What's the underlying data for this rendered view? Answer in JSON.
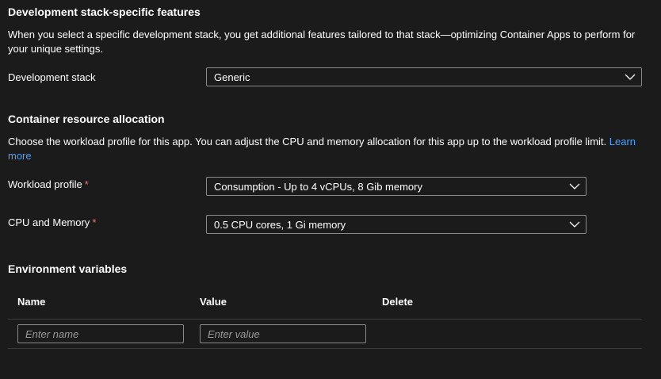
{
  "dev_stack_section": {
    "title": "Development stack-specific features",
    "description": "When you select a specific development stack, you get additional features tailored to that stack—optimizing Container Apps to perform for your unique settings.",
    "field_label": "Development stack",
    "selected_value": "Generic"
  },
  "resource_section": {
    "title": "Container resource allocation",
    "description": "Choose the workload profile for this app. You can adjust the CPU and memory allocation for this app up to the workload profile limit.",
    "learn_more": "Learn more",
    "workload_profile": {
      "label": "Workload profile",
      "required_mark": "*",
      "selected_value": "Consumption - Up to 4 vCPUs, 8 Gib memory"
    },
    "cpu_memory": {
      "label": "CPU and Memory",
      "required_mark": "*",
      "selected_value": "0.5 CPU cores, 1 Gi memory"
    }
  },
  "env_section": {
    "title": "Environment variables",
    "columns": [
      "Name",
      "Value",
      "Delete"
    ],
    "name_placeholder": "Enter name",
    "value_placeholder": "Enter value",
    "name_value": "",
    "value_value": ""
  },
  "colors": {
    "background": "#1b1b1b",
    "text": "#ffffff",
    "link": "#4aa0ff",
    "required": "#f1707b",
    "border": "#8a8a8a"
  },
  "icons": {
    "dropdown": "chevron-down-icon"
  }
}
